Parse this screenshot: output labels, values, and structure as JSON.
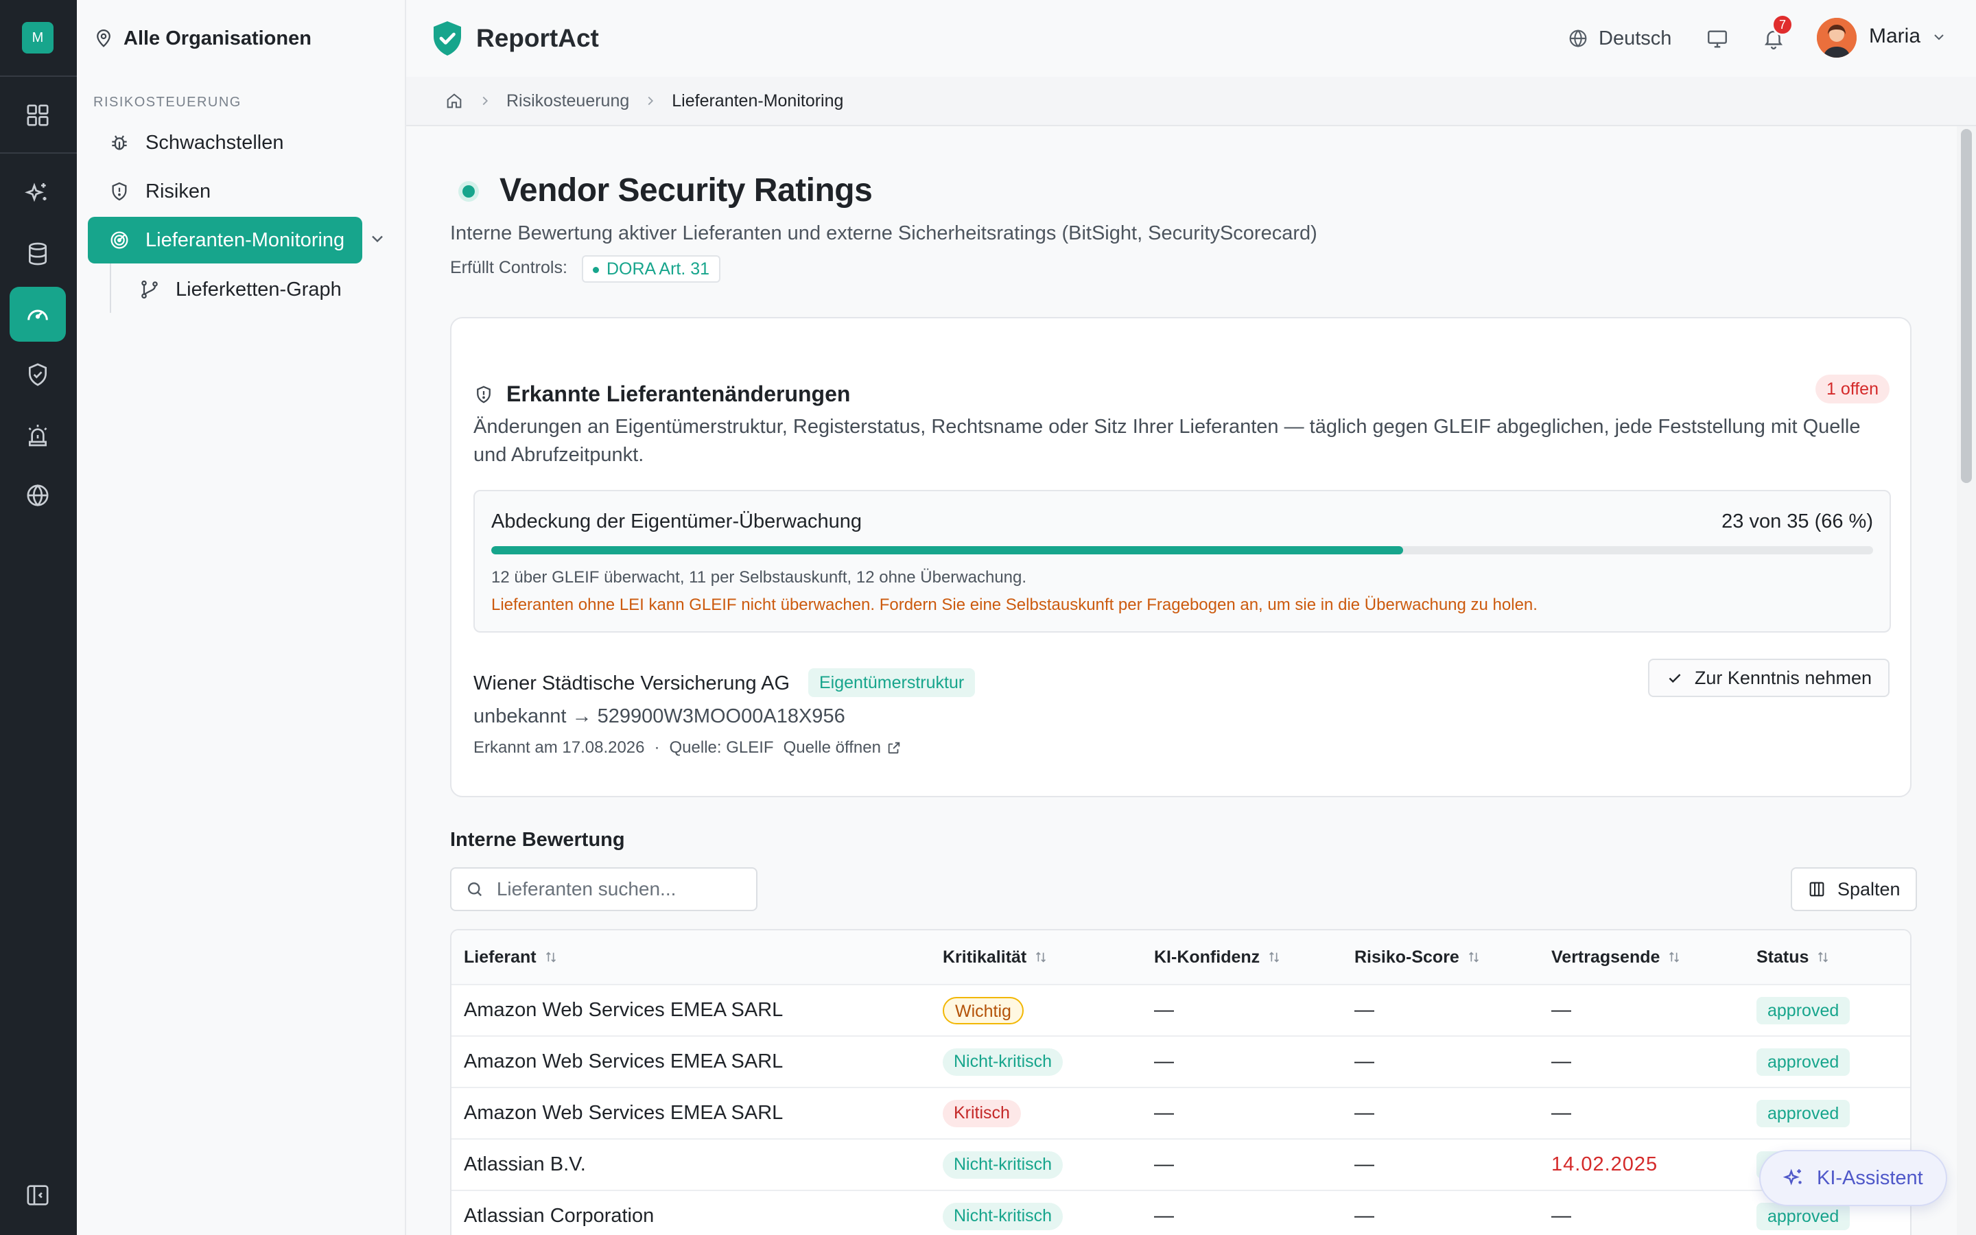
{
  "rail": {
    "avatar_initial": "M",
    "accent": "#17a58c"
  },
  "sidebar": {
    "org_label": "Alle Organisationen",
    "section_label": "RISIKOSTEUERUNG",
    "items": [
      {
        "label": "Schwachstellen",
        "icon": "bug-icon"
      },
      {
        "label": "Risiken",
        "icon": "shield-alert-icon"
      },
      {
        "label": "Lieferanten-Monitoring",
        "icon": "radar-icon",
        "active": true
      },
      {
        "label": "Lieferketten-Graph",
        "icon": "git-branch-icon"
      }
    ]
  },
  "header": {
    "brand": "ReportAct",
    "language": "Deutsch",
    "notifications": "7",
    "user": "Maria"
  },
  "breadcrumb": {
    "items": [
      "Risikosteuerung",
      "Lieferanten-Monitoring"
    ]
  },
  "page": {
    "title": "Vendor Security Ratings",
    "subtitle": "Interne Bewertung aktiver Lieferanten und externe Sicherheitsratings (BitSight, SecurityScorecard)",
    "controls_label": "Erfüllt Controls:",
    "control": "DORA Art. 31"
  },
  "changes_card": {
    "title": "Erkannte Lieferantenänderungen",
    "badge": "1 offen",
    "description": "Änderungen an Eigentümerstruktur, Registerstatus, Rechtsname oder Sitz Ihrer Lieferanten — täglich gegen GLEIF abgeglichen, jede Feststellung mit Quelle und Abrufzeitpunkt.",
    "coverage": {
      "title": "Abdeckung der Eigentümer-Überwachung",
      "value": "23 von 35 (66 %)",
      "percent": 66,
      "note": "12 über GLEIF überwacht, 11 per Selbstauskunft, 12 ohne Überwachung.",
      "warning": "Lieferanten ohne LEI kann GLEIF nicht überwachen. Fordern Sie eine Selbstauskunft per Fragebogen an, um sie in die Überwachung zu holen."
    },
    "change": {
      "vendor": "Wiener Städtische Versicherung AG",
      "tag": "Eigentümerstruktur",
      "diff": "unbekannt → 529900W3MOO00A18X956",
      "detected": "Erkannt am 17.08.2026",
      "dot": "·",
      "source": "Quelle: GLEIF",
      "open_source": "Quelle öffnen",
      "ack_button": "Zur Kenntnis nehmen"
    }
  },
  "assessment": {
    "title": "Interne Bewertung",
    "search_placeholder": "Lieferanten suchen...",
    "columns_button": "Spalten",
    "columns": [
      "Lieferant",
      "Kritikalität",
      "KI-Konfidenz",
      "Risiko-Score",
      "Vertragsende",
      "Status"
    ],
    "rows": [
      {
        "vendor": "Amazon Web Services EMEA SARL",
        "criticality": "Wichtig",
        "crit_class": "p-wichtig",
        "confidence": "—",
        "score": "—",
        "contract_end": "—",
        "status": "approved"
      },
      {
        "vendor": "Amazon Web Services EMEA SARL",
        "criticality": "Nicht-kritisch",
        "crit_class": "p-nk",
        "confidence": "—",
        "score": "—",
        "contract_end": "—",
        "status": "approved"
      },
      {
        "vendor": "Amazon Web Services EMEA SARL",
        "criticality": "Kritisch",
        "crit_class": "p-krit",
        "confidence": "—",
        "score": "—",
        "contract_end": "—",
        "status": "approved"
      },
      {
        "vendor": "Atlassian B.V.",
        "criticality": "Nicht-kritisch",
        "crit_class": "p-nk",
        "confidence": "—",
        "score": "—",
        "contract_end": "14.02.2025",
        "contract_overdue": true,
        "status": "approved"
      },
      {
        "vendor": "Atlassian Corporation",
        "criticality": "Nicht-kritisch",
        "crit_class": "p-nk",
        "confidence": "—",
        "score": "—",
        "contract_end": "—",
        "status": "approved"
      }
    ]
  },
  "assistant_button": "KI-Assistent"
}
